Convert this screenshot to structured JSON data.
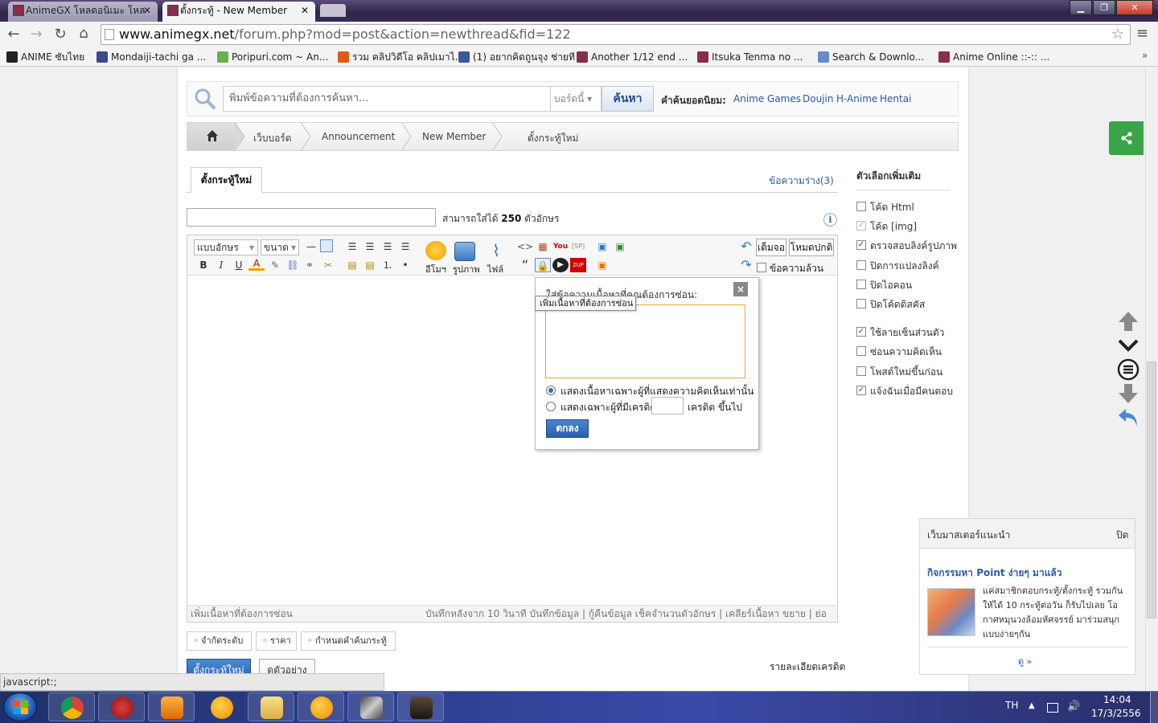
{
  "browser": {
    "tabs": [
      {
        "label": "AnimeGX โหลดอนิเมะ โหล",
        "active": false
      },
      {
        "label": "ตั้งกระทู้ - New Member",
        "active": true
      }
    ],
    "url_host": "www.animegx.net",
    "url_path": "/forum.php?mod=post&action=newthread&fid=122",
    "bookmarks": [
      "ANIME ซับไทย",
      "Mondaiji-tachi ga ...",
      "Poripuri.com ~ An...",
      "รวม คลิปวิดีโอ คลิปเมาไ...",
      "(1) อยากคิดถูนจุง ช่ายที",
      "Another 1/12 end ...",
      "Itsuka Tenma no ...",
      "Search & Downlo...",
      "Anime Online ::-:: ..."
    ],
    "bookmark_more": "»"
  },
  "search": {
    "placeholder": "พิมพ์ข้อความที่ต้องการค้นหา...",
    "scope": "บอร์ดนี้",
    "button": "ค้นหา",
    "hot_label": "คำค้นยอดนิยม:",
    "hot_terms": [
      "Anime",
      "Games",
      "Doujin",
      "H-Anime",
      "Hentai"
    ]
  },
  "breadcrumb": [
    "เว็บบอร์ด",
    "Announcement",
    "New Member",
    "ตั้งกระทู้ใหม่"
  ],
  "post": {
    "tab": "ตั้งกระทู้ใหม่",
    "drafts": "ข้อความร่าง(3)",
    "subject_value": "",
    "limit_prefix": "สามารถใส่ได้",
    "limit_num": "250",
    "limit_suffix": "ตัวอักษร",
    "info": "i"
  },
  "editor": {
    "font_select": "แบบอักษร",
    "size_select": "ขนาด",
    "fmt_buttons": [
      "B",
      "I",
      "U"
    ],
    "emoji_label": "อีโมฯ",
    "image_label": "รูปภาพ",
    "file_label": "ไฟล์",
    "full_label": "เต็มจอ",
    "plain_label": "โหมดปกติ",
    "pure_label": "ข้อความล้วน",
    "status_left": "เพิ่มเนื้อหาที่ต้องการซ่อน",
    "status_right": "บันทึกหลังจาก 10 วินาที บันทึกข้อมูล | กู้คืนข้อมูล     เช็คจำนวนตัวอักษร | เคลียร์เนื้อหา     ขยาย | ย่อ"
  },
  "hide_popup": {
    "title": "ใส่ข้อความเนื้อหาที่คุณต้องการซ่อน:",
    "tooltip": "เพิ่มเนื้อหาที่ต้องการซ่อน",
    "option1": "แสดงเนื้อหาเฉพาะผู้ที่แสดงความคิดเห็นเท่านั้น",
    "option2": "แสดงเฉพาะผู้ที่มีเครดิต",
    "credit_suffix": "เครดิต ขึ้นไป",
    "ok": "ตกลง",
    "close": "×"
  },
  "tags": [
    "จำกัดระดับ",
    "ราคา",
    "กำหนดคำค้นกระทู้"
  ],
  "actions": {
    "submit": "ตั้งกระทู้ใหม่",
    "preview": "ดูตัวอย่าง",
    "credit_detail": "รายละเอียดเครดิต"
  },
  "options": {
    "title": "ตัวเลือกเพิ่มเติม",
    "items": [
      {
        "label": "โค้ด Html",
        "checked": false,
        "disabled": false
      },
      {
        "label": "โค้ด [img]",
        "checked": true,
        "disabled": true
      },
      {
        "label": "ตรวจสอบลิงค์รูปภาพ",
        "checked": true,
        "disabled": false
      },
      {
        "label": "ปิดการแปลงลิงค์",
        "checked": false,
        "disabled": false
      },
      {
        "label": "ปิดไอคอน",
        "checked": false,
        "disabled": false
      },
      {
        "label": "ปิดโค้ดดิสคัส",
        "checked": false,
        "disabled": false
      },
      {
        "label": "ใช้ลายเซ็นส่วนตัว",
        "checked": true,
        "disabled": false
      },
      {
        "label": "ซ่อนความคิดเห็น",
        "checked": false,
        "disabled": false
      },
      {
        "label": "โพสต์ใหม่ขึ้นก่อน",
        "checked": false,
        "disabled": false
      },
      {
        "label": "แจ้งฉันเมื่อมีคนตอบ",
        "checked": true,
        "disabled": false
      }
    ]
  },
  "recommend": {
    "title": "เว็บมาสเตอร์แนะนำ",
    "close": "ปิด",
    "link": "กิจกรรมหา Point ง่ายๆ มาแล้ว",
    "desc": "แค่สมาชิกตอบกระทู้/ตั้งกระทู้ รวมกันให้ได้ 10 กระทู้ต่อวัน ก็รับไปเลย โอกาศหมุนวงล้อมหัศจรรย์ มาร่วมสนุกแบบง่ายๆกัน",
    "more": "ดู »"
  },
  "status_bubble": "javascript:;",
  "taskbar": {
    "lang": "TH",
    "time": "14:04",
    "date": "17/3/2556"
  },
  "colors": {
    "accent": "#2a5aa8",
    "share": "#3aa548",
    "popup_border": "#e7a63a"
  }
}
